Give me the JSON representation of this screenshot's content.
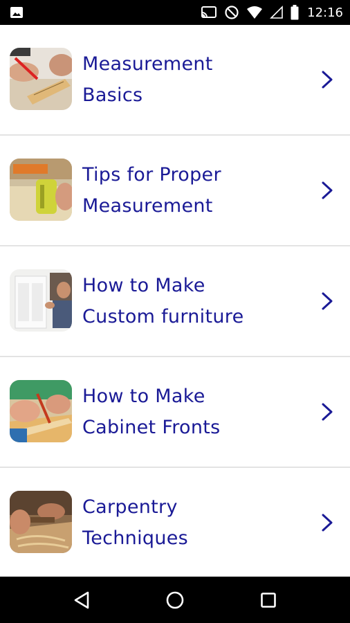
{
  "status_bar": {
    "time": "12:16",
    "icons": [
      "image-icon",
      "cast-icon",
      "do-not-disturb-icon",
      "wifi-icon",
      "signal-icon",
      "battery-icon"
    ]
  },
  "list": {
    "items": [
      {
        "label": "Measurement\nBasics",
        "thumb_icon": "measuring-photo"
      },
      {
        "label": "Tips for Proper\nMeasurement",
        "thumb_icon": "tape-measure-photo"
      },
      {
        "label": "How to Make\nCustom furniture",
        "thumb_icon": "furniture-photo"
      },
      {
        "label": "How to Make\nCabinet Fronts",
        "thumb_icon": "cabinet-marking-photo"
      },
      {
        "label": "Carpentry\nTechniques",
        "thumb_icon": "carpentry-photo"
      }
    ]
  },
  "colors": {
    "label": "#1a1a96",
    "chevron": "#1a1a96",
    "divider": "#e3e3e3",
    "bars": "#000000"
  },
  "nav_bar": {
    "icons": [
      "back-icon",
      "home-icon",
      "recents-icon"
    ]
  }
}
